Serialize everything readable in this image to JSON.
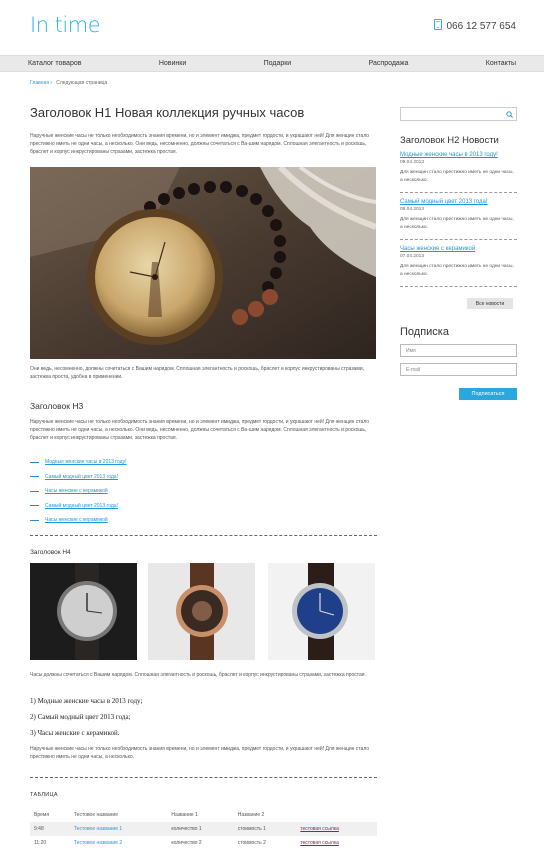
{
  "header": {
    "logo": "In time",
    "phone": "066 12 577 654"
  },
  "nav": [
    "Каталог товаров",
    "Новинки",
    "Подарки",
    "Распродажа",
    "Контакты"
  ],
  "breadcrumb": {
    "home": "Главная",
    "sep": "›",
    "current": "Следующая страница"
  },
  "main": {
    "title": "Заголовок H1 Новая коллекция ручных часов",
    "intro": "Наручные женские часы не только необходимость знания времени, но и элемент имиджа, предмет гордости, и украшают ней! Для женщин стало престижно иметь не одни часы, а несколько. Они ведь, несомненно, должны сочетаться с Ва-шим нарядом. Сплошная элегантность и роскошь, браслет и корпус инкрустированы стразами, застежка простая.",
    "caption": "Они ведь, несомненно, должны сочетаться с Вашим нарядом. Сплошная элегантность и роскошь, браслет и корпус инкрустированы стразами, застежка проста, удобна в применении.",
    "h3": "Заголовок H3",
    "p2": "Наручные женские часы не только необходимость знания времени, но и элемент имиджа, предмет гордости, и украшают ней! Для женщин стало престижно иметь не одни часы, а несколько. Они ведь, несомненно, должны сочетаться с Ва-шим нарядом. Сплошная элегантность и роскошь, браслет и корпус инкрустированы стразами, застежка простая.",
    "links": [
      "Модные женские часы в 2013 году!",
      "Самый модный цвет 2013 года!",
      "Часы женские с керамикой",
      "Самый модный цвет 2013 года!",
      "Часы женские с керамикой"
    ],
    "h4": "Заголовок H4",
    "p3": "Часы должны сочетаться с Вашим нарядом. Сплошная элегантность и роскошь, браслет и корпус инкрустированы стразами, застежка простая.",
    "olist": [
      "1) Модные женские часы в 2013 году;",
      "2) Самый модный цвет 2013 года;",
      "3) Часы женские с керамикой."
    ],
    "p4": "Наручные женские часы не только необходимость знания времени, но и элемент имиджа, предмет гордости, и украшают ней! Для женщин стало престижно иметь не одни часы, а несколько.",
    "table_title": "ТАБЛИЦА",
    "table_headers": [
      "Время",
      "Тестовое название",
      "Название 1",
      "Название 2",
      ""
    ],
    "table_rows": [
      [
        "9:48",
        "Тестовое название 1",
        "количество 1",
        "стоимость 1",
        "тестовая ссылка"
      ],
      [
        "11:20",
        "Тестовое название 2",
        "количество 2",
        "стоимость 2",
        "тестовая ссылка"
      ]
    ]
  },
  "sidebar": {
    "h2": "Заголовок H2 Новости",
    "news": [
      {
        "title": "Модные женские часы в 2013 году!",
        "date": "09.04.2013",
        "text": "Для женщин стало престижно иметь не одни часы, а несколько."
      },
      {
        "title": "Самый модный цвет 2013 года!",
        "date": "08.04.2013",
        "text": "Для женщин стало престижно иметь не одни часы, а несколько."
      },
      {
        "title": "Часы женские с керамикой",
        "date": "07.04.2013",
        "text": "Для женщин стало престижно иметь не одни часы, а несколько."
      }
    ],
    "all_news": "Все новости",
    "subscribe_title": "Подписка",
    "name_placeholder": "Имя",
    "email_placeholder": "E-mail",
    "subscribe_button": "Подписаться"
  },
  "colors": {
    "accent": "#2bb5e0",
    "nav_bg": "#e9e9e9",
    "button": "#2ba7dd"
  }
}
